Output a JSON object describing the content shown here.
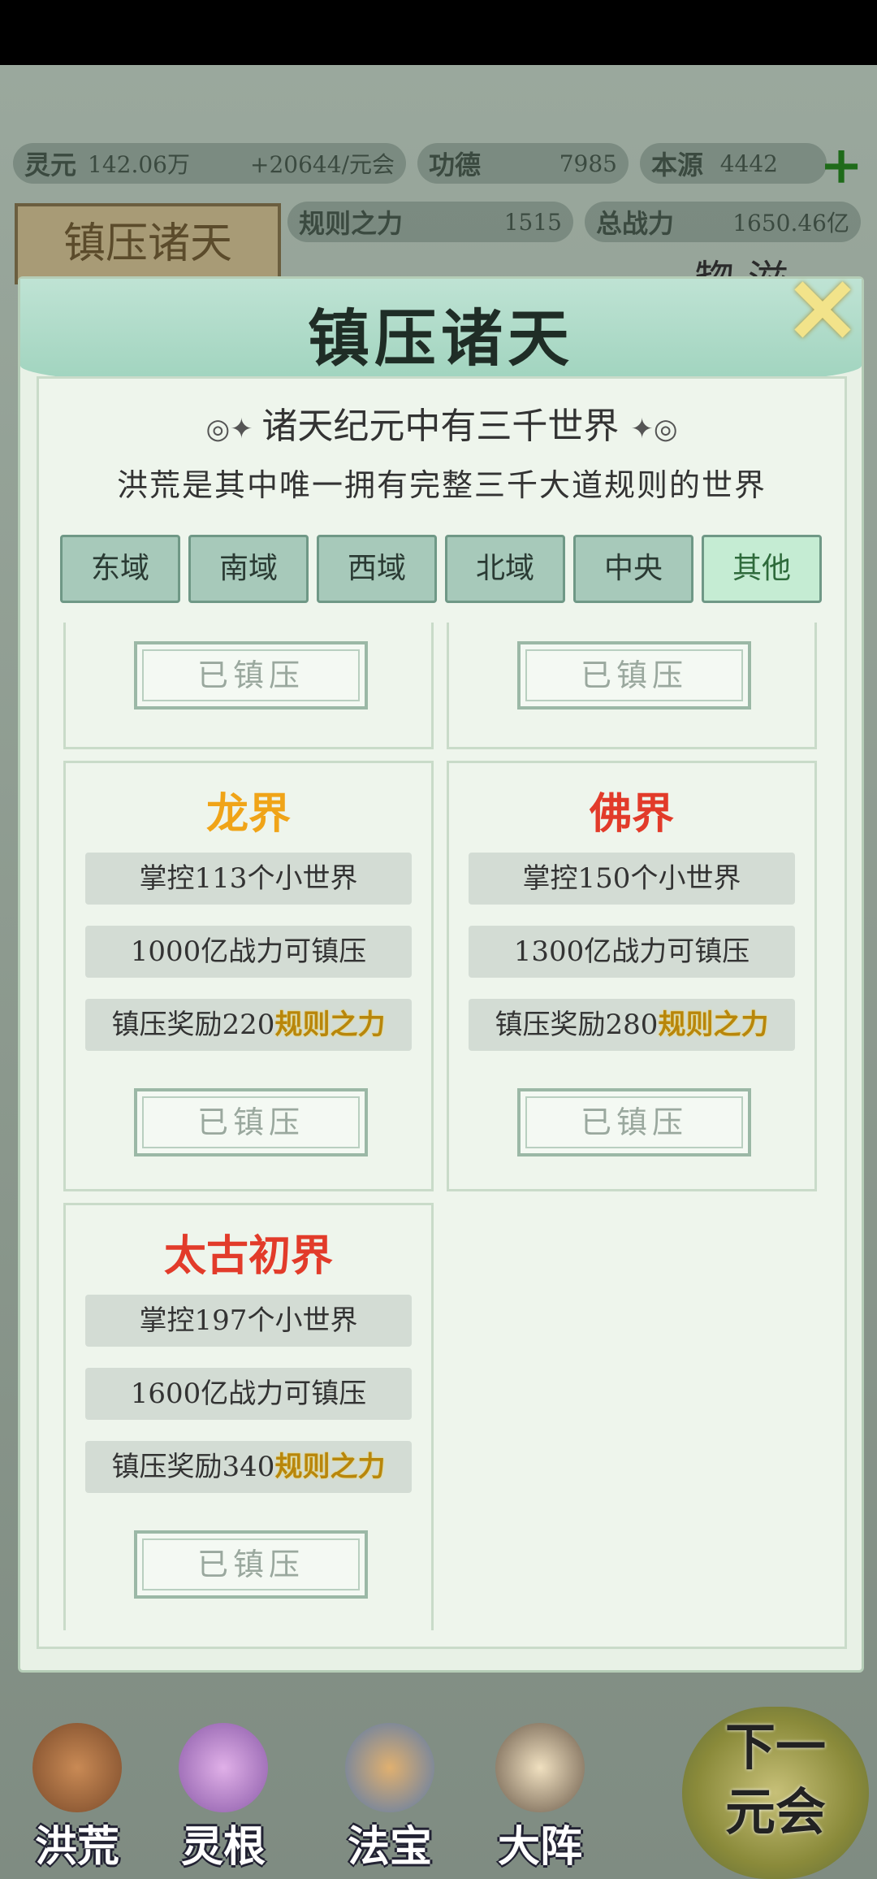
{
  "resources": {
    "lingyuan": {
      "label": "灵元",
      "value": "142.06万",
      "rate": "+20644/元会"
    },
    "gongde": {
      "label": "功德",
      "value": "7985"
    },
    "benyuan": {
      "label": "本源",
      "value": "4442"
    },
    "guize": {
      "label": "规则之力",
      "value": "1515"
    },
    "zongzhanli": {
      "label": "总战力",
      "value": "1650.46亿"
    }
  },
  "page_banner": "镇压诸天",
  "background_glyph": "惣 滋",
  "modal": {
    "title": "镇压诸天",
    "close_icon": "close-icon",
    "intro_line1": "诸天纪元中有三千世界",
    "intro_line2": "洪荒是其中唯一拥有完整三千大道规则的世界",
    "tabs": [
      "东域",
      "南域",
      "西域",
      "北域",
      "中央",
      "其他"
    ],
    "active_tab": "其他",
    "colors": {
      "gold": "#f0a418",
      "red": "#e23b2a",
      "highlight": "#f0d34a"
    },
    "worlds": [
      {
        "name": "",
        "control": "",
        "power": "",
        "reward": "",
        "reward_unit": "",
        "button": "已镇压"
      },
      {
        "name": "",
        "control": "",
        "power": "",
        "reward": "",
        "reward_unit": "",
        "button": "已镇压"
      },
      {
        "name": "龙界",
        "name_color": "#f0a418",
        "control": "掌控113个小世界",
        "power": "1000亿战力可镇压",
        "reward": "镇压奖励220",
        "reward_unit": "规则之力",
        "button": "已镇压"
      },
      {
        "name": "佛界",
        "name_color": "#e23b2a",
        "control": "掌控150个小世界",
        "power": "1300亿战力可镇压",
        "reward": "镇压奖励280",
        "reward_unit": "规则之力",
        "button": "已镇压"
      },
      {
        "name": "太古初界",
        "name_color": "#e23b2a",
        "control": "掌控197个小世界",
        "power": "1600亿战力可镇压",
        "reward": "镇压奖励340",
        "reward_unit": "规则之力",
        "button": "已镇压"
      }
    ]
  },
  "bottom_nav": {
    "items": [
      "洪荒",
      "灵根",
      "法宝",
      "大阵"
    ],
    "next": "下一元会"
  }
}
